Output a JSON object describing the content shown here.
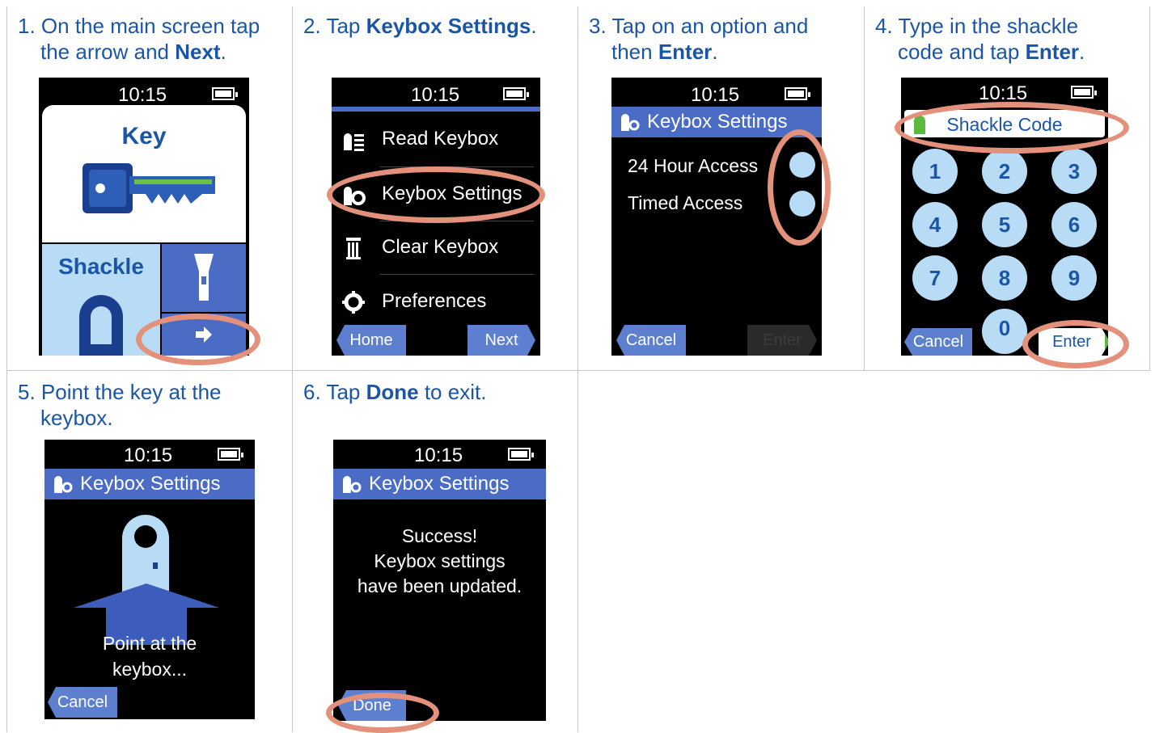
{
  "steps": [
    {
      "num": "1.",
      "pre": "On the main screen tap",
      "line2_pre": "the arrow and ",
      "bold": "Next",
      "post": "."
    },
    {
      "num": "2.",
      "pre": "Tap ",
      "bold": "Keybox Settings",
      "post": "."
    },
    {
      "num": "3.",
      "pre": "Tap on an option and",
      "line2_pre": "then ",
      "bold": "Enter",
      "post": "."
    },
    {
      "num": "4.",
      "pre": "Type in the shackle",
      "line2_pre": "code and tap ",
      "bold": "Enter",
      "post": "."
    },
    {
      "num": "5.",
      "pre": "Point the key at the",
      "line2_pre": "keybox."
    },
    {
      "num": "6.",
      "pre": "Tap ",
      "bold": "Done",
      "post": " to exit."
    }
  ],
  "device": {
    "time": "10:15"
  },
  "screen1": {
    "key_label": "Key",
    "shackle_label": "Shackle"
  },
  "screen2": {
    "menu": [
      {
        "label": "Read Keybox",
        "icon": "read-keybox-icon"
      },
      {
        "label": "Keybox Settings",
        "icon": "keybox-settings-icon"
      },
      {
        "label": "Clear Keybox",
        "icon": "trash-icon"
      },
      {
        "label": "Preferences",
        "icon": "gear-icon"
      }
    ],
    "home": "Home",
    "next": "Next"
  },
  "screen3": {
    "title": "Keybox Settings",
    "options": [
      "24 Hour Access",
      "Timed Access"
    ],
    "cancel": "Cancel",
    "enter": "Enter"
  },
  "screen4": {
    "field": "Shackle Code",
    "keys": [
      "1",
      "2",
      "3",
      "4",
      "5",
      "6",
      "7",
      "8",
      "9",
      "0"
    ],
    "cancel": "Cancel",
    "enter": "Enter"
  },
  "screen5": {
    "title": "Keybox Settings",
    "message_line1": "Point at the",
    "message_line2": "keybox...",
    "cancel": "Cancel"
  },
  "screen6": {
    "title": "Keybox Settings",
    "line1": "Success!",
    "line2": "Keybox settings",
    "line3": "have been updated.",
    "done": "Done"
  },
  "colors": {
    "instruction_text": "#1b56a6",
    "highlight_oval": "#e3917a",
    "title_bar": "#4a6cc4",
    "light_blue": "#b8dcf5"
  }
}
